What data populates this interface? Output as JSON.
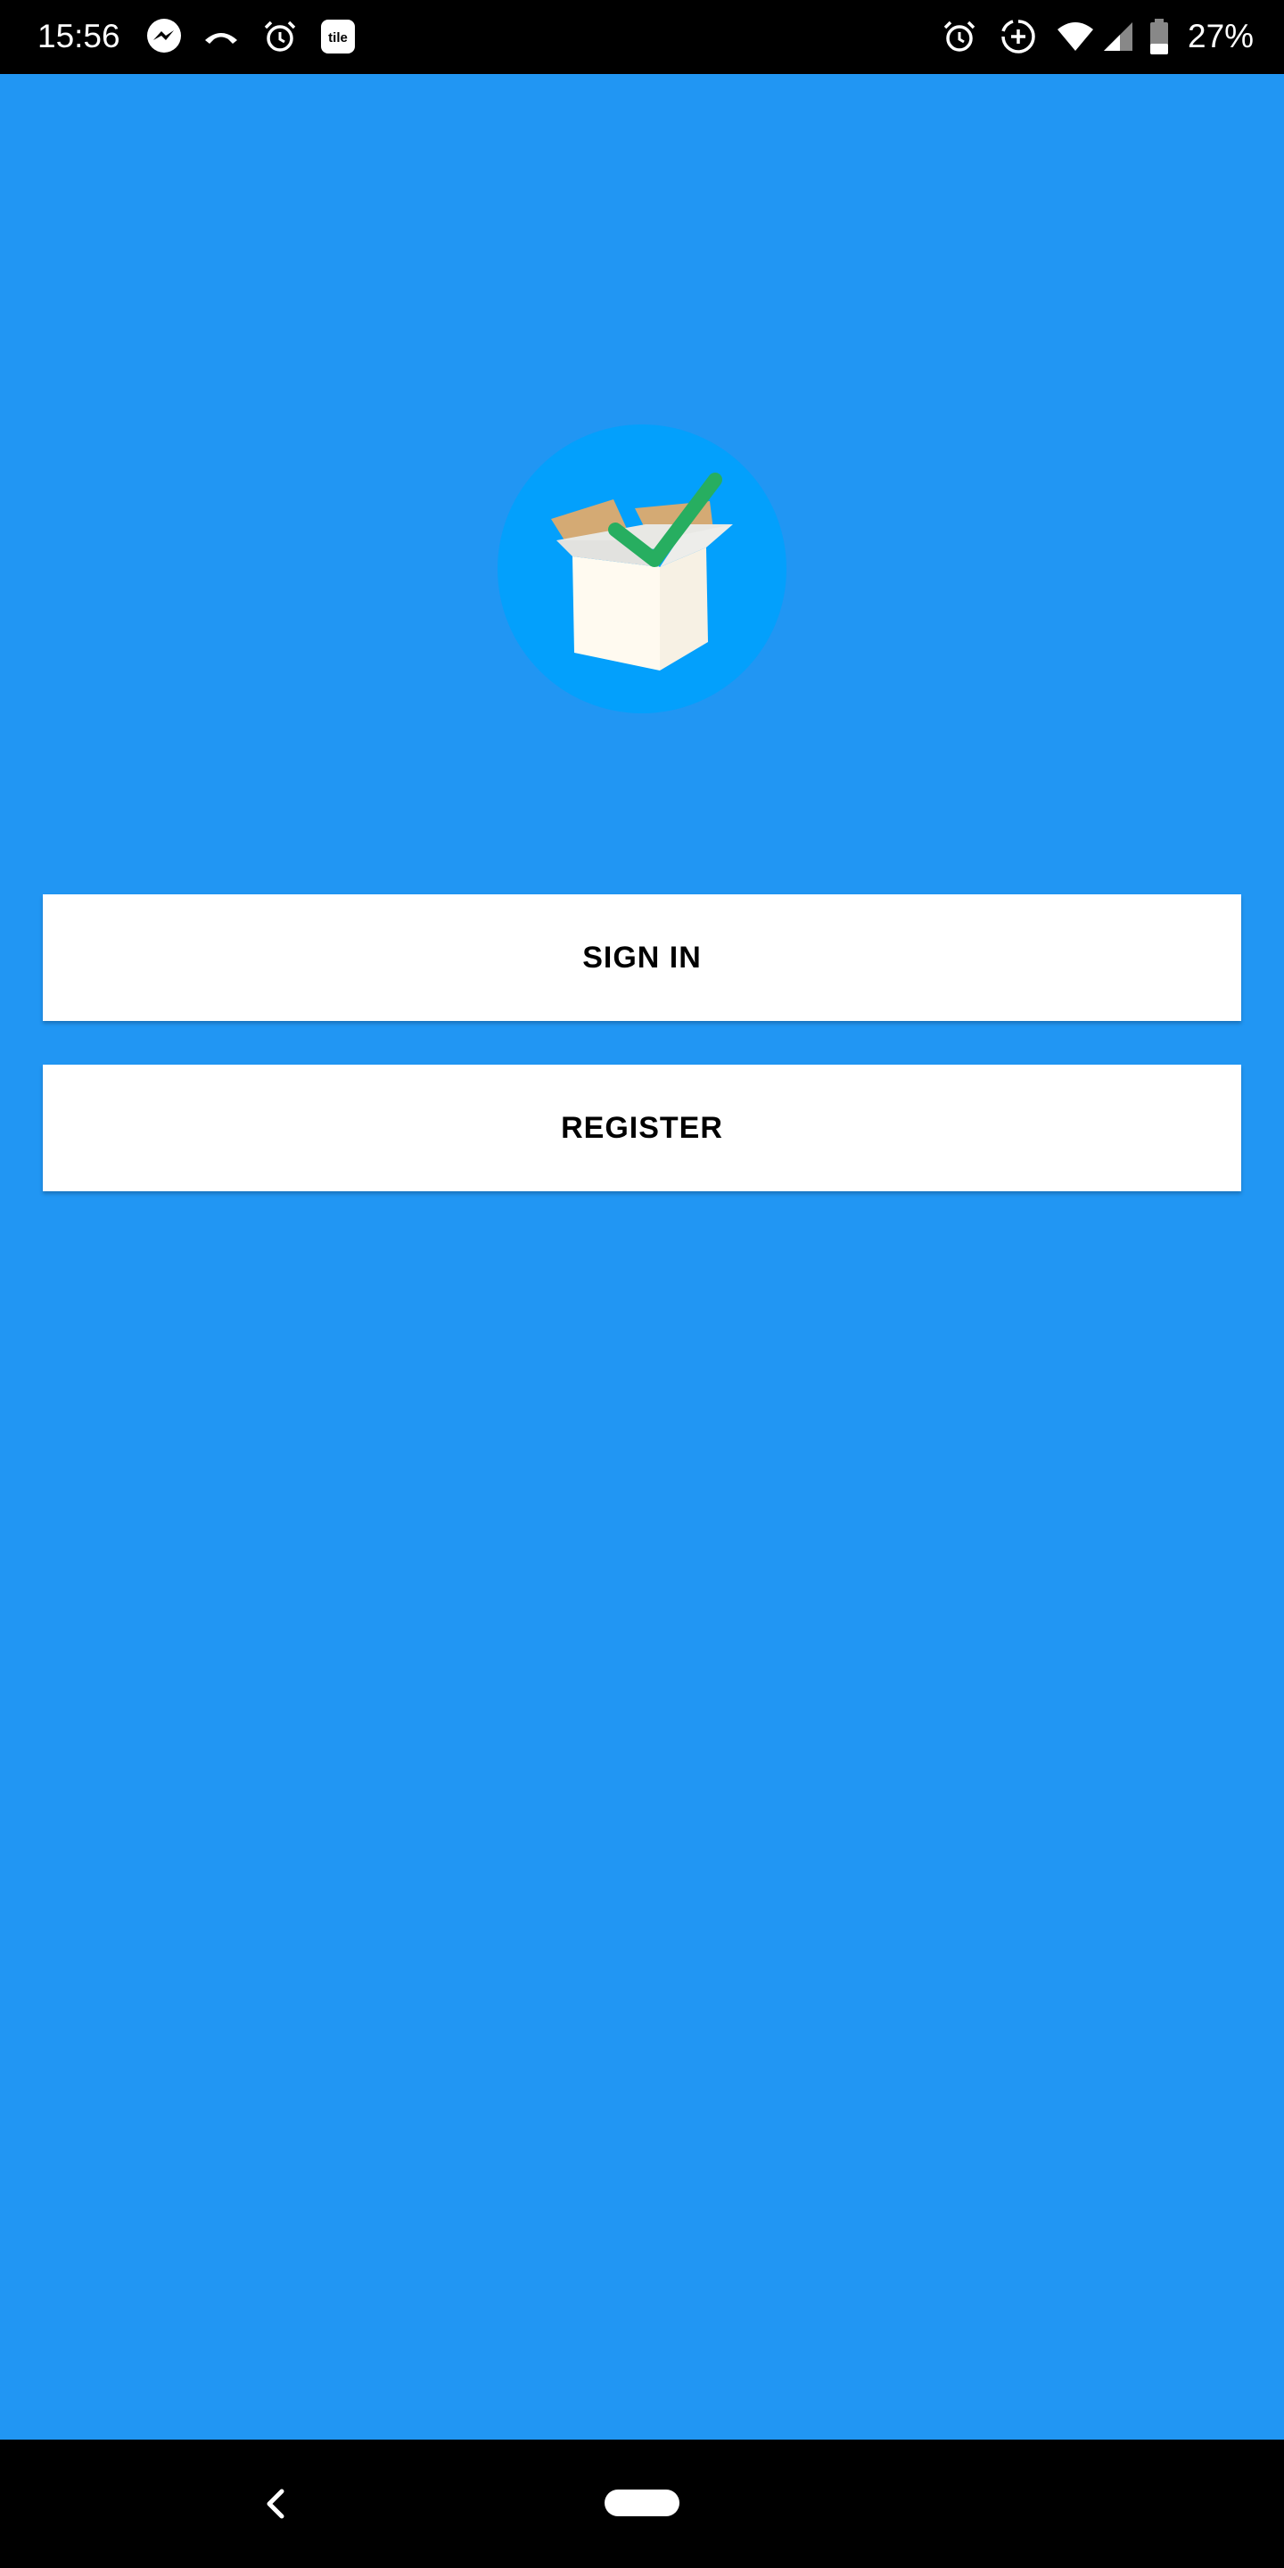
{
  "status_bar": {
    "time": "15:56",
    "battery_percent": "27%",
    "left_icons": [
      "messenger-icon",
      "phone-icon",
      "alarm-icon",
      "tile-app-icon"
    ],
    "right_icons": [
      "alarm-icon",
      "data-saver-icon",
      "wifi-icon",
      "cell-signal-icon",
      "battery-icon"
    ],
    "tile_label": "tile"
  },
  "app": {
    "background_color": "#2196f3",
    "logo_icon": "open-box-checkmark-icon"
  },
  "buttons": {
    "sign_in_label": "SIGN IN",
    "register_label": "REGISTER"
  },
  "nav_bar": {
    "icons": [
      "back-icon",
      "home-pill-icon"
    ]
  }
}
